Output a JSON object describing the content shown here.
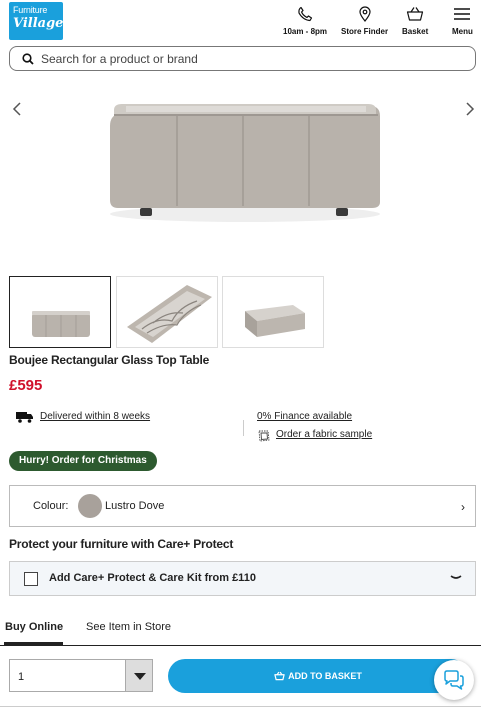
{
  "header": {
    "logo_line1": "Furniture",
    "logo_line2": "Village",
    "phone_label": "10am - 8pm",
    "store_finder_label": "Store Finder",
    "basket_label": "Basket",
    "menu_label": "Menu"
  },
  "search": {
    "placeholder": "Search for a product or brand"
  },
  "product": {
    "title": "Boujee Rectangular Glass Top Table",
    "price": "£595",
    "delivery": "Delivered within 8 weeks",
    "finance": "0% Finance available",
    "fabric_sample": "Order a fabric sample",
    "badge": "Hurry! Order for Christmas"
  },
  "colour": {
    "label": "Colour:",
    "value": "Lustro Dove",
    "swatch_color": "#a8a19b"
  },
  "care": {
    "title": "Protect your furniture with Care+ Protect",
    "option": "Add Care+ Protect & Care Kit from £110"
  },
  "tabs": [
    {
      "label": "Buy Online",
      "active": true
    },
    {
      "label": "See Item in Store",
      "active": false
    }
  ],
  "purchase": {
    "quantity": "1",
    "add_label": "ADD TO BASKET"
  },
  "colors": {
    "brand_blue": "#1aa0dc",
    "price_red": "#d0102b",
    "badge_green": "#2d5a2f"
  }
}
